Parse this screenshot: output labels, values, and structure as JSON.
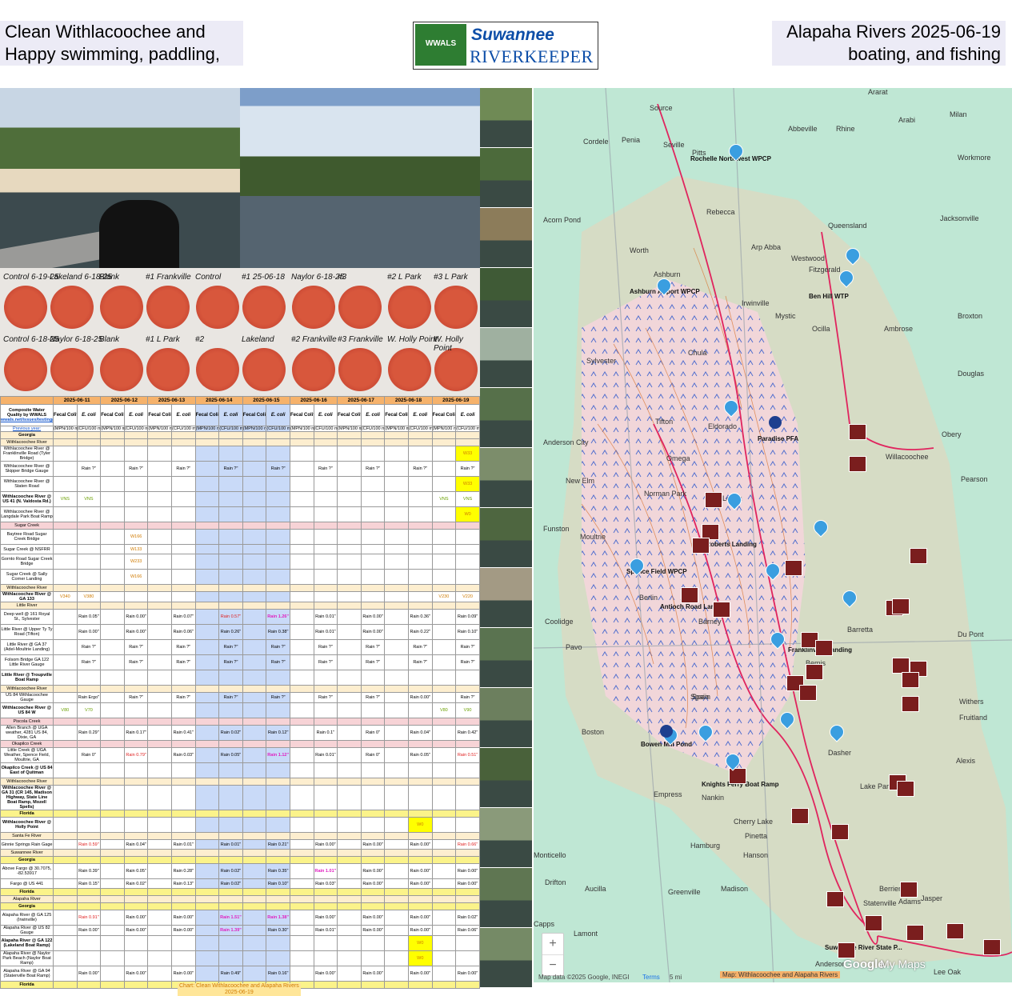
{
  "header": {
    "left_line1": "Clean Withlacoochee and",
    "left_line2": "Happy swimming, paddling,",
    "right_line1": "Alapaha Rivers 2025-06-19",
    "right_line2": "boating, and fishing",
    "logo_wwals": "WWALS",
    "logo_line1": "Suwannee",
    "logo_line2": "RIVERKEEPER"
  },
  "dish_labels": [
    "Control 6-19-25",
    "Lakeland 6-18-25",
    "Control 6-18-25",
    "Naylor 6-18-25",
    "Blank",
    "#1 Frankville",
    "Blank",
    "#1 L Park",
    "Control",
    "#1 25-06-18",
    "#2",
    "Lakeland",
    "Naylor 6-18-25",
    "#3",
    "#2 Frankville",
    "#3 Frankville",
    "#2 L Park",
    "#3 L Park",
    "W. Holly Point",
    "W. Holly Point"
  ],
  "table": {
    "title": "Composite Water Quality by WWALS",
    "link": "wwals.net/issues/testing/",
    "previous_year": "Previous year:",
    "dates": [
      "2025-06-11",
      "2025-06-12",
      "2025-06-13",
      "2025-06-14",
      "2025-06-15",
      "2025-06-16",
      "2025-06-17",
      "2025-06-18",
      "2025-06-19"
    ],
    "col_a": "Fecal Coliform",
    "col_b": "E. coli",
    "unit_a": "(MPN/100 mL)",
    "unit_b": "(CFU/100 mL)",
    "rows": [
      {
        "kind": "sec",
        "name": "Georgia"
      },
      {
        "kind": "sub",
        "name": "Withlacoochee River"
      },
      {
        "name": "Withlacoochee River @ Franklinville Road (Tyler Bridge)",
        "cells": {
          "17": "W33"
        }
      },
      {
        "name": "Withlacoochee River @ Skipper Bridge Gauge",
        "rain": [
          "Rain ?\"",
          "Rain ?\"",
          "Rain ?\"",
          "Rain ?\"",
          "Rain ?\"",
          "Rain ?\"",
          "Rain ?\"",
          "Rain ?\"",
          "Rain ?\""
        ]
      },
      {
        "name": "Withlacoochee River @ Staten Road",
        "cells": {
          "17": "W33"
        }
      },
      {
        "name": "Withlacoochee River @ US 41 (N. Valdosta Rd.)",
        "bold": true,
        "cells": {
          "0": "VNS",
          "1": "VNS",
          "16": "VNS",
          "17": "VNS"
        }
      },
      {
        "name": "Withlacoochee River @ Langdale Park Boat Ramp",
        "cells": {
          "17": "W0"
        }
      },
      {
        "kind": "pink",
        "name": "Sugar Creek"
      },
      {
        "name": "Baytree Road Sugar Creek Bridge",
        "cells": {
          "3": "W166"
        }
      },
      {
        "name": "Sugar Creek @ NSFRR",
        "cells": {
          "3": "W133"
        }
      },
      {
        "name": "Gornto Road Sugar Creek Bridge",
        "cells": {
          "3": "W233"
        }
      },
      {
        "name": "Sugar Creek @ Sally Corner Landing",
        "cells": {
          "3": "W166"
        }
      },
      {
        "kind": "sub",
        "name": "Withlacoochee River"
      },
      {
        "name": "Withlacoochee River @ GA 133",
        "bold": true,
        "cells": {
          "0": "V340",
          "1": "V380",
          "16": "V230",
          "17": "V220"
        }
      },
      {
        "kind": "sub",
        "name": "Little River"
      },
      {
        "name": "Deep well @ 161 Royal St., Sylvester",
        "rain": [
          "Rain 0.05\"",
          "Rain 0.00\"",
          "Rain 0.07\"",
          "Rain 0.57\"",
          "Rain 1.26\"",
          "Rain 0.01\"",
          "Rain 0.00\"",
          "Rain 0.36\"",
          "Rain 0.09\""
        ]
      },
      {
        "name": "Little River @ Upper Ty Ty Road (Tifton)",
        "rain": [
          "Rain 0.00\"",
          "Rain 0.00\"",
          "Rain 0.06\"",
          "Rain 0.26\"",
          "Rain 0.38\"",
          "Rain 0.01\"",
          "Rain 0.00\"",
          "Rain 0.22\"",
          "Rain 0.10\""
        ]
      },
      {
        "name": "Little River @ GA 37 (Adel-Moultrie Landing)",
        "rain": [
          "Rain ?\"",
          "Rain ?\"",
          "Rain ?\"",
          "Rain ?\"",
          "Rain ?\"",
          "Rain ?\"",
          "Rain ?\"",
          "Rain ?\"",
          "Rain ?\""
        ]
      },
      {
        "name": "Folsom Bridge GA 122 Little River Gauge",
        "rain": [
          "Rain ?\"",
          "Rain ?\"",
          "Rain ?\"",
          "Rain ?\"",
          "Rain ?\"",
          "Rain ?\"",
          "Rain ?\"",
          "Rain ?\"",
          "Rain ?\""
        ]
      },
      {
        "name": "Little River @ Troupville Boat Ramp",
        "bold": true
      },
      {
        "kind": "sub",
        "name": "Withlacoochee River"
      },
      {
        "name": "US 84 Withlacoochee Gauge",
        "rain": [
          "Rain Ergo\"",
          "Rain ?\"",
          "Rain ?\"",
          "Rain ?\"",
          "Rain ?\"",
          "Rain ?\"",
          "Rain ?\"",
          "Rain 0.00\"",
          "Rain ?\""
        ]
      },
      {
        "name": "Withlacoochee River @ US 84 W",
        "bold": true,
        "cells": {
          "0": "V80",
          "1": "V70",
          "16": "V80",
          "17": "V90"
        }
      },
      {
        "kind": "pink",
        "name": "Piscola Creek"
      },
      {
        "name": "Allen Branch @ UGA weather, 4281 US 84, Dixie, GA",
        "rain": [
          "Rain 0.29\"",
          "Rain 0.17\"",
          "Rain 0.41\"",
          "Rain 0.02\"",
          "Rain 0.12\"",
          "Rain 0.1\"",
          "Rain 0\"",
          "Rain 0.04\"",
          "Rain 0.42\""
        ]
      },
      {
        "kind": "pink",
        "name": "Okapilco Creek"
      },
      {
        "name": "Little Creek @ UGA Weather, Spence Field, Moultrie, GA",
        "rain": [
          "Rain 0\"",
          "Rain 0.79\"",
          "Rain 0.03\"",
          "Rain 0.05\"",
          "Rain 1.12\"",
          "Rain 0.01\"",
          "Rain 0\"",
          "Rain 0.05\"",
          "Rain 0.51\""
        ]
      },
      {
        "name": "Okapilco Creek @ US 84 East of Quitman",
        "bold": true
      },
      {
        "kind": "sub",
        "name": "Withlacoochee River"
      },
      {
        "name": "Withlacoochee River @ GA 31 (CR 145, Madison Highway, State Line Boat Ramp, Mozell Spells)",
        "bold": true
      },
      {
        "kind": "yel",
        "name": "Florida"
      },
      {
        "name": "Withlacoochee River @ Holly Point",
        "bold": true,
        "cells": {
          "15": "W0"
        }
      },
      {
        "kind": "sub",
        "name": "Santa Fe River"
      },
      {
        "name": "Ginnie Springs Rain Gage",
        "rain": [
          "Rain 0.59\"",
          "Rain 0.04\"",
          "Rain 0.01\"",
          "Rain 0.01\"",
          "Rain 0.21\"",
          "Rain 0.00\"",
          "Rain 0.00\"",
          "Rain 0.00\"",
          "Rain 0.66\""
        ]
      },
      {
        "kind": "sub",
        "name": "Suwannee River"
      },
      {
        "kind": "yel",
        "name": "Georgia"
      },
      {
        "name": "Above Fargo @ 30.7075, -82.53917",
        "rain": [
          "Rain 0.39\"",
          "Rain 0.05\"",
          "Rain 0.28\"",
          "Rain 0.02\"",
          "Rain 0.35\"",
          "Rain 1.01\"",
          "Rain 0.00\"",
          "Rain 0.00\"",
          "Rain 0.00\""
        ]
      },
      {
        "name": "Fargo @ US 441",
        "rain": [
          "Rain 0.15\"",
          "Rain 0.02\"",
          "Rain 0.13\"",
          "Rain 0.02\"",
          "Rain 0.10\"",
          "Rain 0.03\"",
          "Rain 0.00\"",
          "Rain 0.00\"",
          "Rain 0.00\""
        ]
      },
      {
        "kind": "yel",
        "name": "Florida"
      },
      {
        "kind": "sub",
        "name": "Alapaha River"
      },
      {
        "kind": "yel",
        "name": "Georgia"
      },
      {
        "name": "Alapaha River @ GA 125 (Irwinville)",
        "rain": [
          "Rain 0.91\"",
          "Rain 0.00\"",
          "Rain 0.00\"",
          "Rain 1.51\"",
          "Rain 1.38\"",
          "Rain 0.00\"",
          "Rain 0.00\"",
          "Rain 0.00\"",
          "Rain 0.02\""
        ]
      },
      {
        "name": "Alapaha River @ US 82 Gauge",
        "rain": [
          "Rain 0.00\"",
          "Rain 0.00\"",
          "Rain 0.00\"",
          "Rain 1.39\"",
          "Rain 0.30\"",
          "Rain 0.01\"",
          "Rain 0.00\"",
          "Rain 0.00\"",
          "Rain 0.06\""
        ]
      },
      {
        "name": "Alapaha River @ GA 122 (Lakeland Boat Ramp)",
        "bold": true,
        "cells": {
          "15": "W0"
        }
      },
      {
        "name": "Alapaha River @ Naylor Park Beach (Naylor Boat Ramp)",
        "cells": {
          "15": "W0"
        }
      },
      {
        "name": "Alapaha River @ GA 94 (Statenville Boat Ramp)",
        "rain": [
          "Rain 0.00\"",
          "Rain 0.00\"",
          "Rain 0.00\"",
          "Rain 0.49\"",
          "Rain 0.16\"",
          "Rain 0.00\"",
          "Rain 0.00\"",
          "Rain 0.00\"",
          "Rain 0.00\""
        ]
      },
      {
        "kind": "yel",
        "name": "Florida"
      }
    ],
    "caption_line1": "Chart: Clean Withlacoochee and Alapaha Rivers",
    "caption_line2": "2025-06-19"
  },
  "map": {
    "labels": [
      "Source",
      "Cordele",
      "Penia",
      "Seville",
      "Pitts",
      "Rochelle Northwest WPCP",
      "Abbeville",
      "Rhine",
      "Arabi",
      "Workmore",
      "Milan",
      "Ararat",
      "Rebecca",
      "Queensland",
      "Jacksonville",
      "Acorn Pond",
      "Ashburn",
      "Ashburn Airport WPCP",
      "Worth",
      "Arp Abba",
      "Westwood",
      "Fitzgerald",
      "Ben Hill WTP",
      "Irwinville",
      "Mystic",
      "Ocilla",
      "Ambrose",
      "Broxton",
      "Chula",
      "Paradise PFA",
      "Willacoochee",
      "Eldorado",
      "Anderson City",
      "New Elm",
      "Omega",
      "Norman Park",
      "Lenox",
      "Funston",
      "Moultrie",
      "Spence Field WPCP",
      "Red Roberts Landing",
      "Berlin",
      "Antioch Road Landing",
      "Barney",
      "Coolidge",
      "Pavo",
      "Franklinville Landing",
      "Barretta",
      "Bemis",
      "Boston",
      "Bowen Mill Pond",
      "Spain",
      "Dasher",
      "Empress",
      "Knights Ferry Boat Ramp",
      "Nankin",
      "Lake Park",
      "Cherry Lake",
      "Hamburg",
      "Monticello",
      "Madison",
      "Greenville",
      "Aucilla",
      "Lamont",
      "Pinetta",
      "Hanson",
      "Jasper",
      "Drifton",
      "Capps",
      "Douglas",
      "Pearson",
      "Obery",
      "Withers",
      "Alexis",
      "Du Pont",
      "Fruitland",
      "Statenville",
      "Suwannee River State P...",
      "Anderson",
      "Lee Oak",
      "Berrien",
      "Spain",
      "Sylvester",
      "Tifton",
      "Adams"
    ],
    "attribution": "Map data ©2025 Google, INEGI",
    "terms": "Terms",
    "scale": "5 mi",
    "google": "Google",
    "mymaps": "My Maps",
    "caption": "Map: Withlacoochee and Alapaha Rivers",
    "zoom_in": "+",
    "zoom_out": "−"
  },
  "colors": {
    "date_header": "#f6b26b",
    "section_band": "#fdeecf",
    "florida_band": "#fbf38a",
    "weekend_blue": "#c9daf8",
    "rain_high": "#e02020",
    "rain_extreme": "#e020c0",
    "map_water": "#bfe7d4",
    "river": "#e0245e"
  }
}
